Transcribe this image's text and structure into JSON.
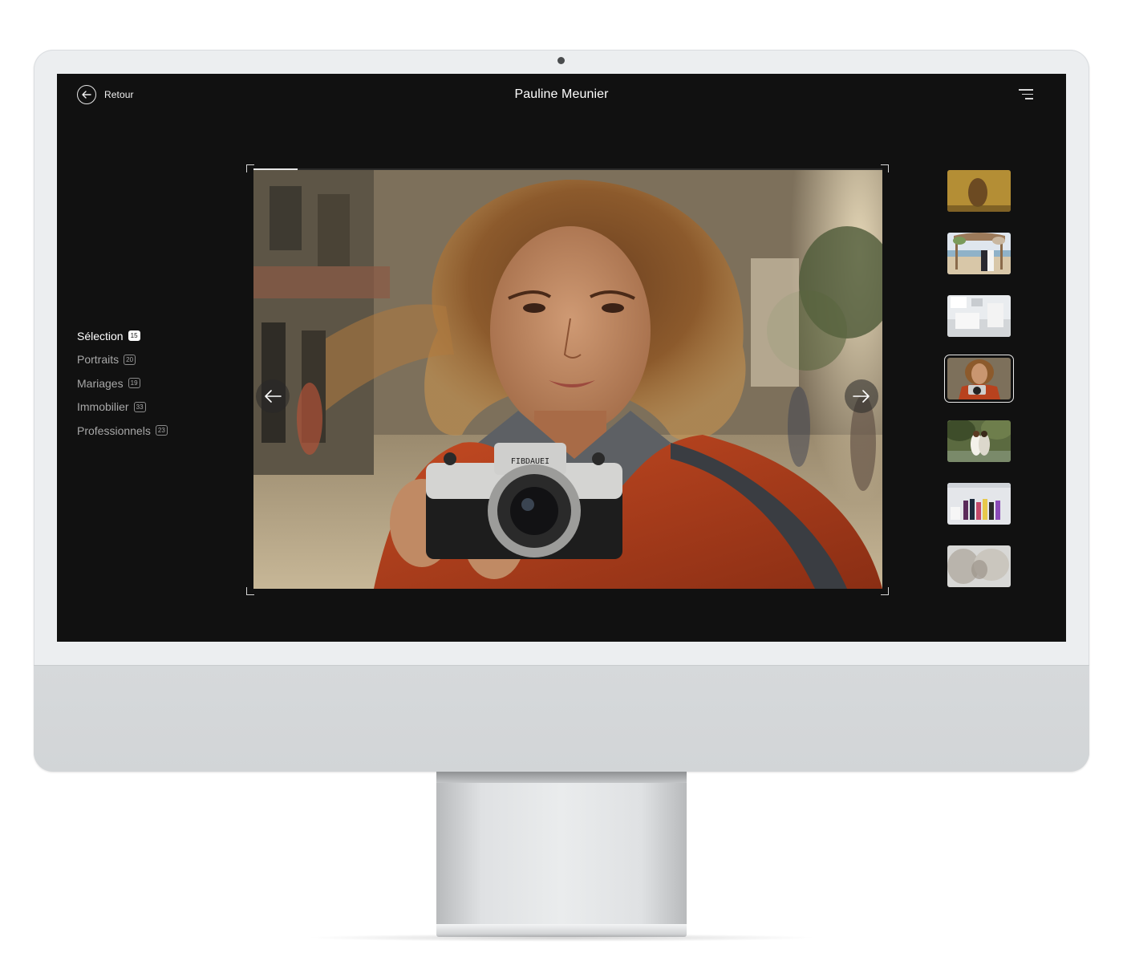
{
  "header": {
    "back_label": "Retour",
    "title": "Pauline Meunier"
  },
  "categories": [
    {
      "label": "Sélection",
      "count": "15",
      "active": true
    },
    {
      "label": "Portraits",
      "count": "20",
      "active": false
    },
    {
      "label": "Mariages",
      "count": "19",
      "active": false
    },
    {
      "label": "Immobilier",
      "count": "33",
      "active": false
    },
    {
      "label": "Professionnels",
      "count": "23",
      "active": false
    }
  ],
  "viewer": {
    "progress_fraction": 0.07,
    "camera_brand": "FIBDAUEI"
  },
  "thumbnails": [
    {
      "subject": "golden blurred portrait",
      "active": false
    },
    {
      "subject": "wedding couple beach arch",
      "active": false
    },
    {
      "subject": "white kitchen interior",
      "active": false
    },
    {
      "subject": "woman with camera",
      "active": true
    },
    {
      "subject": "couple under trees",
      "active": false
    },
    {
      "subject": "clothing rack boutique",
      "active": false
    },
    {
      "subject": "blurred interior",
      "active": false
    }
  ],
  "icons": {
    "back": "arrow-left-circle-icon",
    "menu": "hamburger-menu-icon",
    "prev": "arrow-left-icon",
    "next": "arrow-right-icon"
  }
}
